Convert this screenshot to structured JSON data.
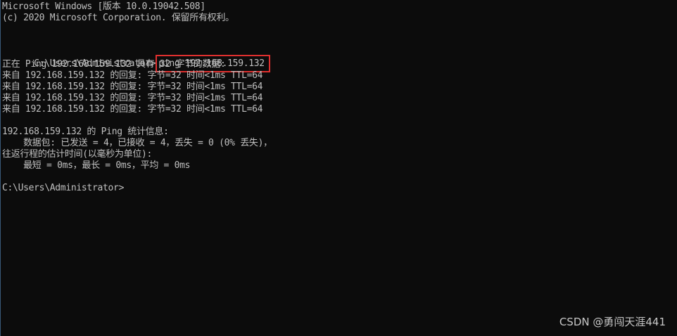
{
  "console": {
    "lines": [
      "Microsoft Windows [版本 10.0.19042.508]",
      "(c) 2020 Microsoft Corporation. 保留所有权利。",
      "",
      "",
      "",
      "正在 Ping 192.168.159.132 具有 32 字节的数据:",
      "来自 192.168.159.132 的回复: 字节=32 时间<1ms TTL=64",
      "来自 192.168.159.132 的回复: 字节=32 时间<1ms TTL=64",
      "来自 192.168.159.132 的回复: 字节=32 时间<1ms TTL=64",
      "来自 192.168.159.132 的回复: 字节=32 时间<1ms TTL=64",
      "",
      "192.168.159.132 的 Ping 统计信息:",
      "    数据包: 已发送 = 4，已接收 = 4，丢失 = 0 (0% 丢失)，",
      "往返行程的估计时间(以毫秒为单位):",
      "    最短 = 0ms，最长 = 0ms，平均 = 0ms",
      "",
      "C:\\Users\\Administrator>"
    ],
    "prompt": "C:\\Users\\Administrator>",
    "command": "ping 192.168.159.132"
  },
  "watermark": "CSDN @勇闯天涯441",
  "colors": {
    "background": "#0c0c0c",
    "text": "#c0c0c0",
    "highlight_box": "#e0302f"
  }
}
